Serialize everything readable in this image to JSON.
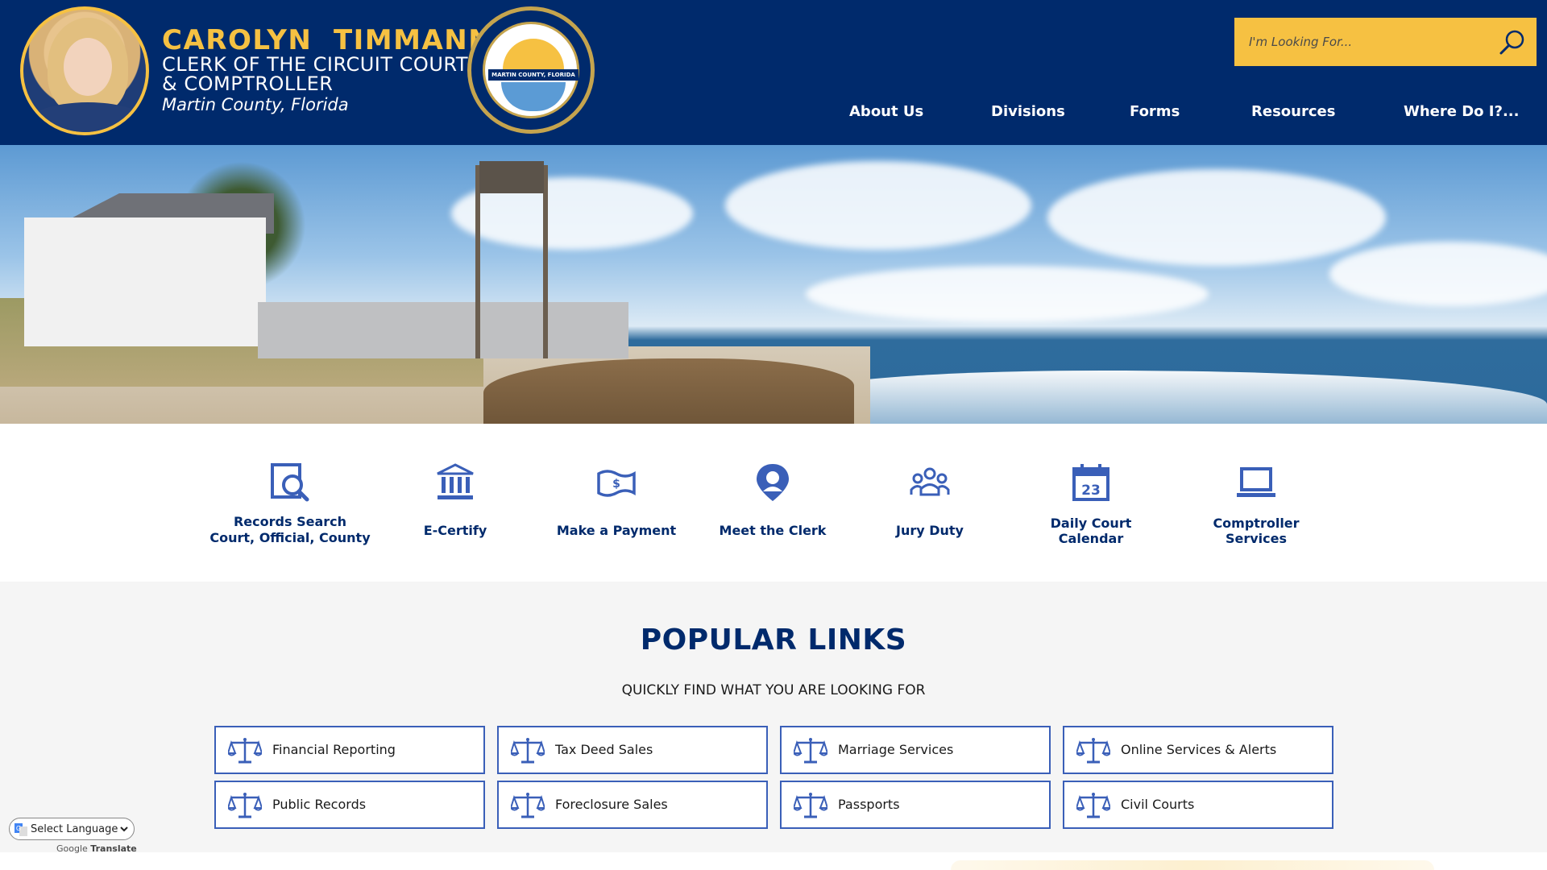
{
  "header": {
    "name": "CAROLYN  TIMMANN",
    "title_line1": "CLERK OF THE CIRCUIT COURT",
    "title_line2": "& COMPTROLLER",
    "county": "Martin County, Florida",
    "seal_band_text": "MARTIN COUNTY, FLORIDA"
  },
  "search": {
    "placeholder": "I'm Looking For..."
  },
  "nav": [
    {
      "label": "About Us"
    },
    {
      "label": "Divisions"
    },
    {
      "label": "Forms"
    },
    {
      "label": "Resources"
    },
    {
      "label": "Where Do I?..."
    }
  ],
  "quick_links": [
    {
      "line1": "Records Search",
      "line2": "Court, Official, County",
      "icon": "records-search-icon"
    },
    {
      "line1": "E-Certify",
      "line2": "",
      "icon": "courthouse-icon"
    },
    {
      "line1": "Make a Payment",
      "line2": "",
      "icon": "payment-icon"
    },
    {
      "line1": "Meet the Clerk",
      "line2": "",
      "icon": "clerk-pin-icon"
    },
    {
      "line1": "Jury Duty",
      "line2": "",
      "icon": "people-icon"
    },
    {
      "line1": "Daily Court",
      "line2": "Calendar",
      "icon": "calendar-icon"
    },
    {
      "line1": "Comptroller",
      "line2": "Services",
      "icon": "laptop-icon"
    }
  ],
  "calendar_day": "23",
  "popular": {
    "title": "POPULAR LINKS",
    "subtitle": "QUICKLY FIND WHAT YOU ARE LOOKING FOR",
    "links": [
      {
        "label": "Financial Reporting"
      },
      {
        "label": "Tax Deed Sales"
      },
      {
        "label": "Marriage Services"
      },
      {
        "label": "Online Services & Alerts"
      },
      {
        "label": "Public Records"
      },
      {
        "label": "Foreclosure Sales"
      },
      {
        "label": "Passports"
      },
      {
        "label": "Civil Courts"
      }
    ]
  },
  "translate": {
    "select_label": "Select Language",
    "powered_by": "Google",
    "translate_label": "Translate"
  },
  "colors": {
    "navy": "#002a6c",
    "gold": "#f6c142",
    "link_border": "#3a5fb8",
    "icon_blue": "#3a5fb8"
  }
}
